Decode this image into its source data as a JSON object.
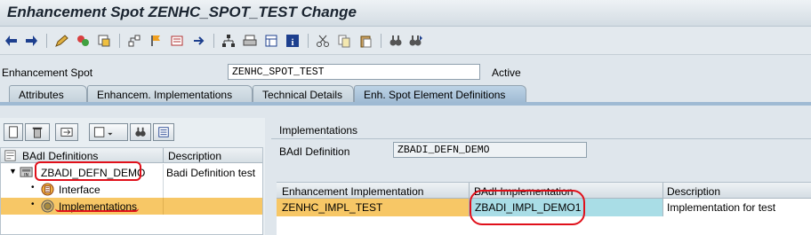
{
  "window": {
    "title": "Enhancement Spot ZENHC_SPOT_TEST Change"
  },
  "toolbar": {
    "icons": [
      "back-arrow-icon",
      "forward-arrow-icon",
      "edit-display-icon",
      "other-object-icon",
      "activate-icon",
      "where-used-icon",
      "flag-icon",
      "display-object-list-icon",
      "navigation-window-icon",
      "hierarchy-icon",
      "print-icon",
      "layout-icon",
      "info-icon",
      "cut-icon",
      "copy-icon",
      "paste-icon",
      "find-icon",
      "find-next-icon"
    ]
  },
  "spot": {
    "label": "Enhancement Spot",
    "value": "ZENHC_SPOT_TEST",
    "status": "Active"
  },
  "tabs": [
    {
      "label": "Attributes"
    },
    {
      "label": "Enhancem. Implementations"
    },
    {
      "label": "Technical Details"
    },
    {
      "label": "Enh. Spot Element Definitions"
    }
  ],
  "tree": {
    "col_definitions": "BAdI Definitions",
    "col_description": "Description",
    "rows": [
      {
        "label": "ZBADI_DEFN_DEMO",
        "description": "Badi Definition test"
      },
      {
        "label": "Interface",
        "description": ""
      },
      {
        "label": "Implementations",
        "description": ""
      }
    ]
  },
  "implementations_panel": {
    "heading": "Implementations",
    "badi_label": "BAdI Definition",
    "badi_value": "ZBADI_DEFN_DEMO",
    "columns": [
      "Enhancement Implementation",
      "BAdI Implementation",
      "Description"
    ],
    "rows": [
      {
        "enh_impl": "ZENHC_IMPL_TEST",
        "badi_impl": "ZBADI_IMPL_DEMO1",
        "description": "Implementation for test"
      }
    ]
  },
  "colors": {
    "selected_row": "#f7c766",
    "badi_cell": "#a9dde6",
    "annotation": "#e0101a"
  }
}
